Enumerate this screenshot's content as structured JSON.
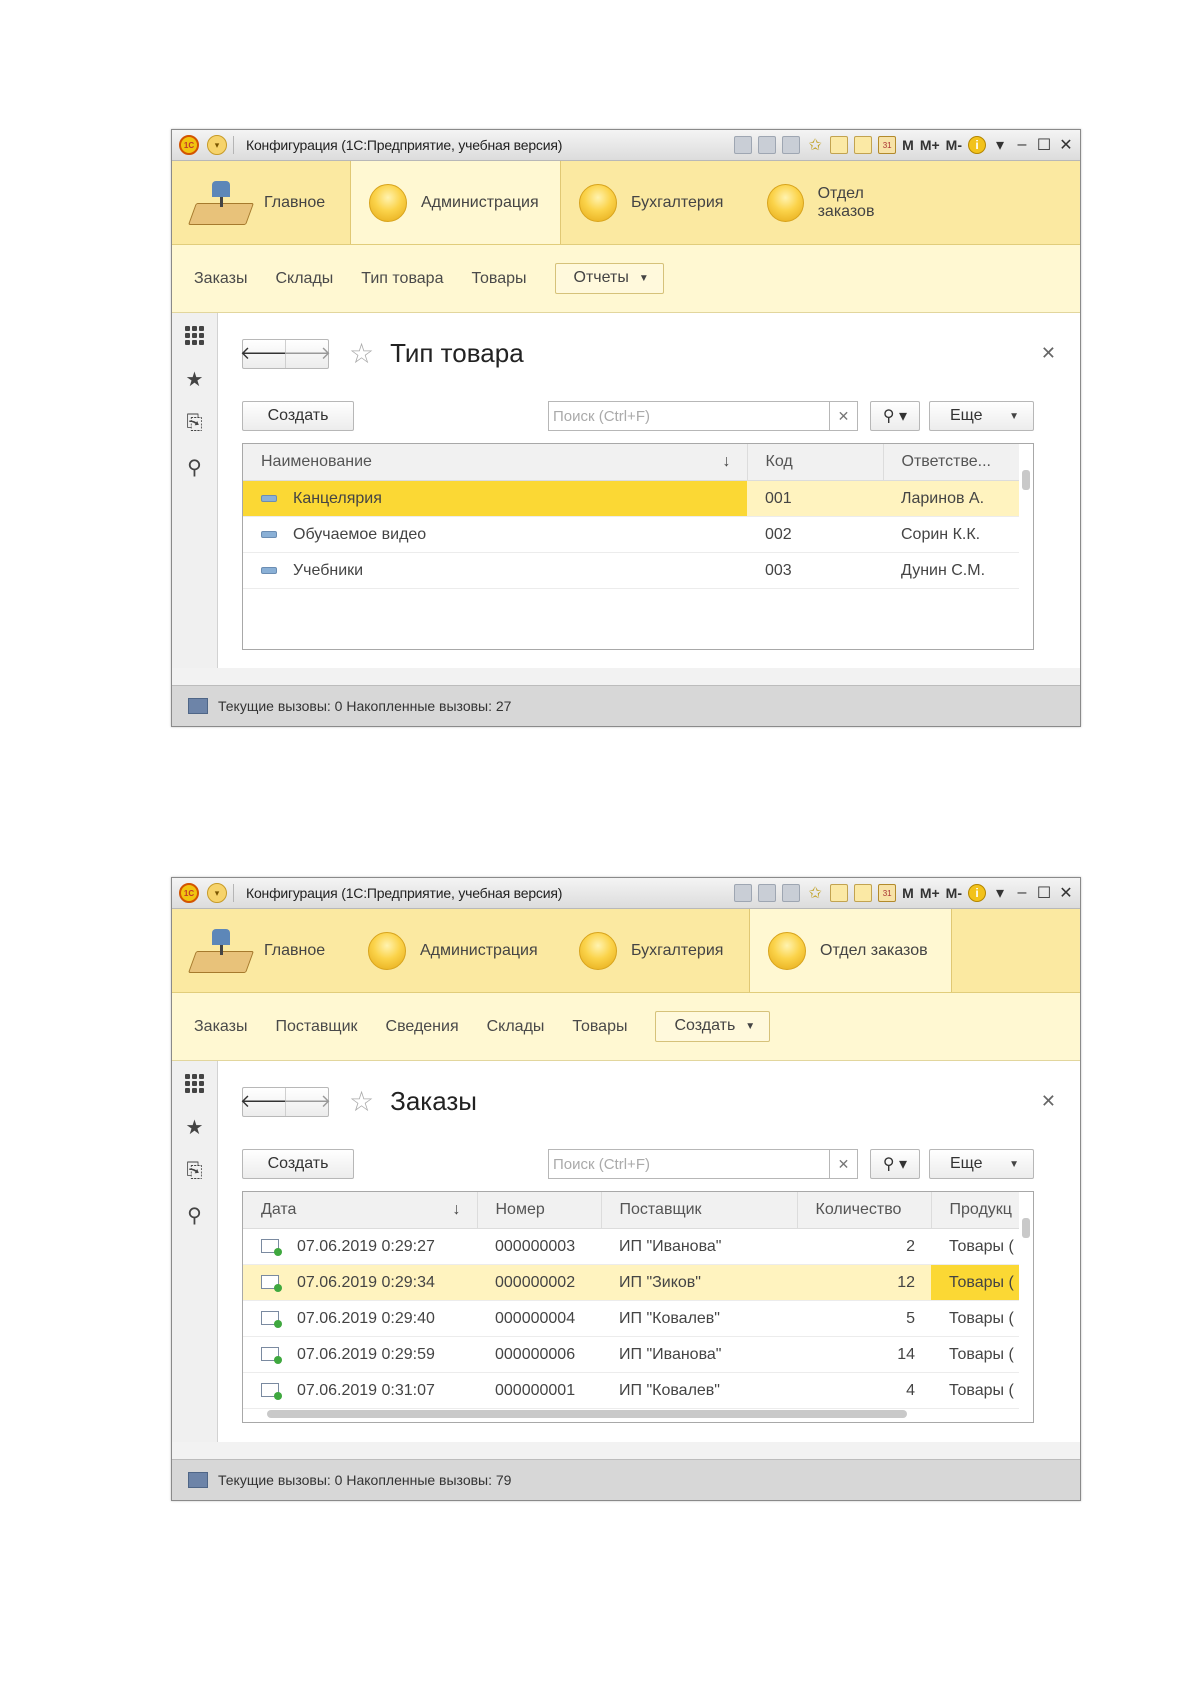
{
  "windows": [
    {
      "title": "Конфигурация  (1С:Предприятие, учебная версия)",
      "toolbar": {
        "m": "M",
        "mplus": "M+",
        "mminus": "M-",
        "calendar": "31"
      },
      "sections": [
        {
          "label": "Главное"
        },
        {
          "label": "Администрация"
        },
        {
          "label": "Бухгалтерия"
        },
        {
          "label": "Отдел заказов"
        }
      ],
      "active_section": "Администрация",
      "nav": {
        "links": [
          "Заказы",
          "Склады",
          "Тип товара",
          "Товары"
        ],
        "dropdown": "Отчеты"
      },
      "form": {
        "title": "Тип товара",
        "create": "Создать",
        "search_placeholder": "Поиск (Ctrl+F)",
        "more": "Еще"
      },
      "table": {
        "columns": [
          "Наименование",
          "Код",
          "Ответстве..."
        ],
        "rows": [
          {
            "name": "Канцелярия",
            "code": "001",
            "resp": "Ларинов А."
          },
          {
            "name": "Обучаемое видео",
            "code": "002",
            "resp": "Сорин К.К."
          },
          {
            "name": "Учебники",
            "code": "003",
            "resp": "Дунин С.М."
          }
        ],
        "selected_row": 0
      },
      "status": "Текущие вызовы: 0   Накопленные вызовы: 27"
    },
    {
      "title": "Конфигурация  (1С:Предприятие, учебная версия)",
      "toolbar": {
        "m": "M",
        "mplus": "M+",
        "mminus": "M-",
        "calendar": "31"
      },
      "sections": [
        {
          "label": "Главное"
        },
        {
          "label": "Администрация"
        },
        {
          "label": "Бухгалтерия"
        },
        {
          "label": "Отдел заказов"
        }
      ],
      "active_section": "Отдел заказов",
      "nav": {
        "links": [
          "Заказы",
          "Поставщик",
          "Сведения",
          "Склады",
          "Товары"
        ],
        "dropdown": "Создать"
      },
      "form": {
        "title": "Заказы",
        "create": "Создать",
        "search_placeholder": "Поиск (Ctrl+F)",
        "more": "Еще"
      },
      "table": {
        "columns": [
          "Дата",
          "Номер",
          "Поставщик",
          "Количество",
          "Продукц"
        ],
        "rows": [
          {
            "date": "07.06.2019 0:29:27",
            "number": "000000003",
            "supplier": "ИП \"Иванова\"",
            "qty": "2",
            "product": "Товары ("
          },
          {
            "date": "07.06.2019 0:29:34",
            "number": "000000002",
            "supplier": "ИП \"Зиков\"",
            "qty": "12",
            "product": "Товары ("
          },
          {
            "date": "07.06.2019 0:29:40",
            "number": "000000004",
            "supplier": "ИП \"Ковалев\"",
            "qty": "5",
            "product": "Товары ("
          },
          {
            "date": "07.06.2019 0:29:59",
            "number": "000000006",
            "supplier": "ИП \"Иванова\"",
            "qty": "14",
            "product": "Товары ("
          },
          {
            "date": "07.06.2019 0:31:07",
            "number": "000000001",
            "supplier": "ИП \"Ковалев\"",
            "qty": "4",
            "product": "Товары ("
          }
        ],
        "selected_row": 1
      },
      "status": "Текущие вызовы: 0   Накопленные вызовы: 79"
    }
  ],
  "icons": {
    "section_main": "desk-lamp-icon",
    "section_other": "yellow-ball-icon",
    "left_panel": [
      "grid-menu-icon",
      "favorites-star-icon",
      "history-icon",
      "search-icon"
    ]
  },
  "colors": {
    "sections_bg": "#fbe9a1",
    "nav_bg": "#fff8d2",
    "selected_cell": "#fbd834",
    "selected_row": "#fff3bf",
    "statusbar_bg": "#d7d7d7"
  }
}
